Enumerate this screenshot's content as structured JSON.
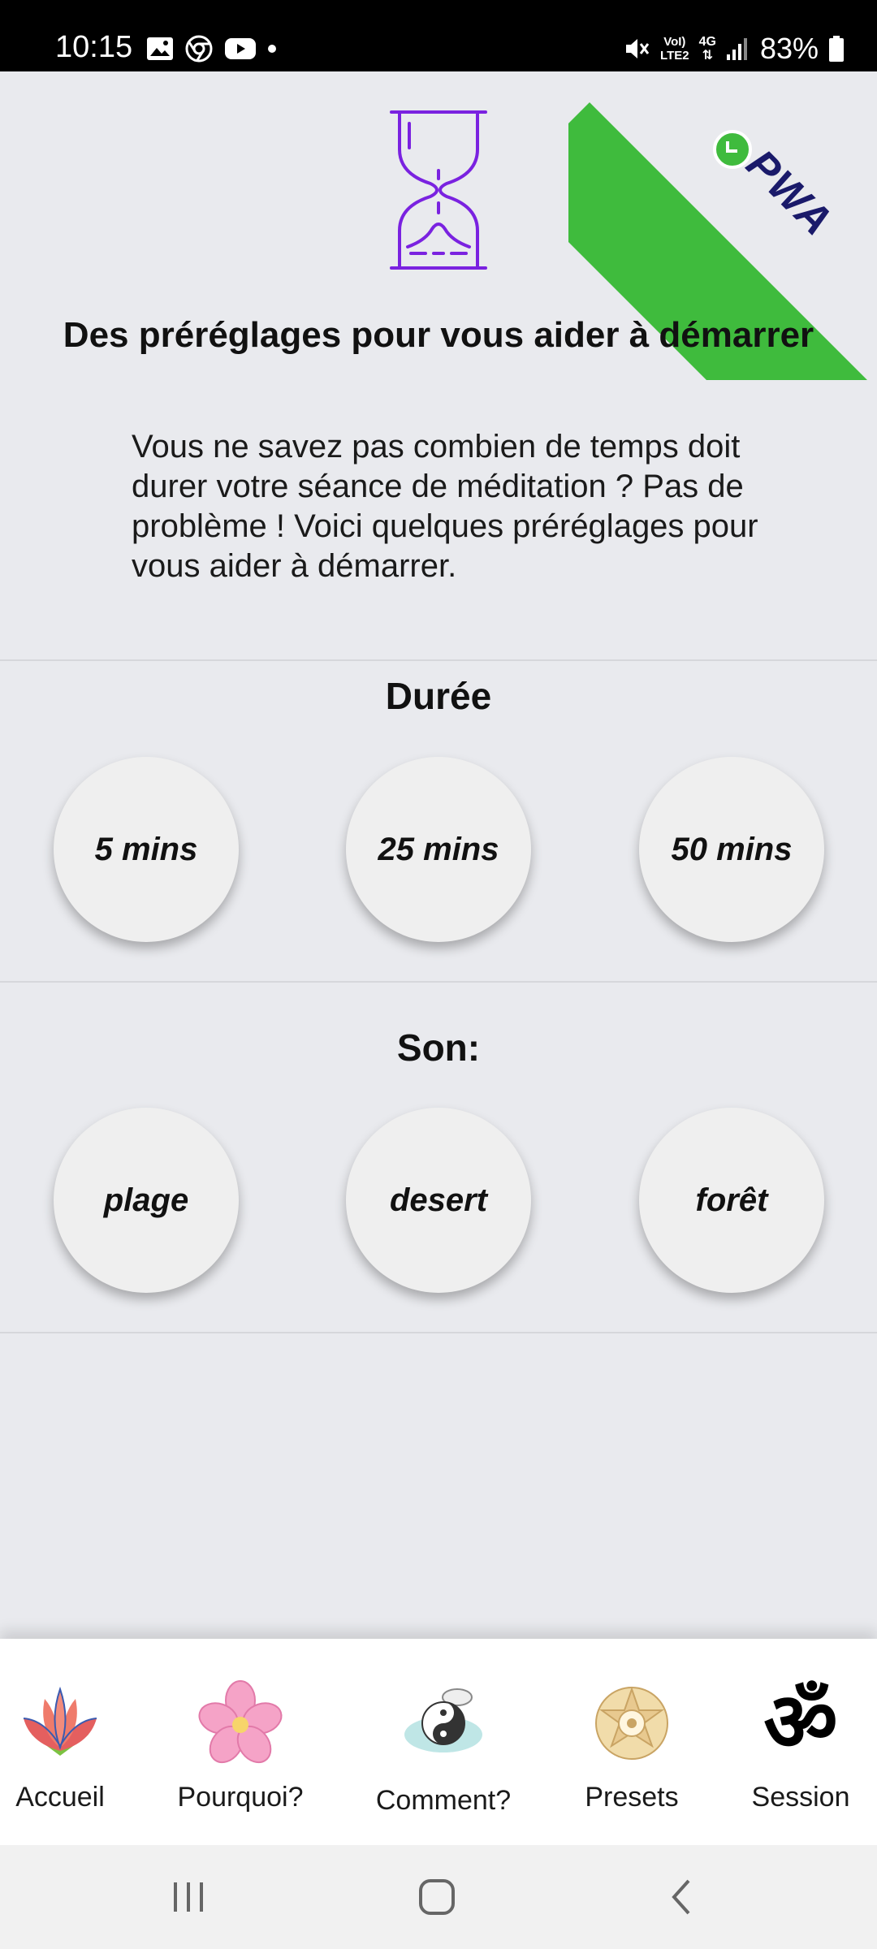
{
  "status_bar": {
    "time": "10:15",
    "network_top": "VoI)",
    "network_bottom": "LTE2",
    "network_type": "4G",
    "battery": "83%"
  },
  "badge": {
    "text": "PWA",
    "color": "#3fbb3d"
  },
  "header": {
    "title": "Des préréglages pour vous aider à démarrer",
    "intro": "Vous ne savez pas combien de temps doit durer votre séance de méditation ? Pas de problème ! Voici quelques préréglages pour vous aider à démarrer."
  },
  "duration": {
    "title": "Durée",
    "options": [
      "5 mins",
      "25 mins",
      "50 mins"
    ]
  },
  "sound": {
    "title": "Son:",
    "options": [
      "plage",
      "desert",
      "forêt"
    ]
  },
  "bottom_nav": {
    "items": [
      {
        "label": "Accueil",
        "icon": "lotus-icon"
      },
      {
        "label": "Pourquoi?",
        "icon": "flower-icon"
      },
      {
        "label": "Comment?",
        "icon": "yin-yang-icon"
      },
      {
        "label": "Presets",
        "icon": "mandala-icon"
      },
      {
        "label": "Session",
        "icon": "om-icon"
      }
    ]
  },
  "colors": {
    "accent": "#7a22e0",
    "background": "#e9eaee",
    "ribbon": "#3fbb3d"
  }
}
